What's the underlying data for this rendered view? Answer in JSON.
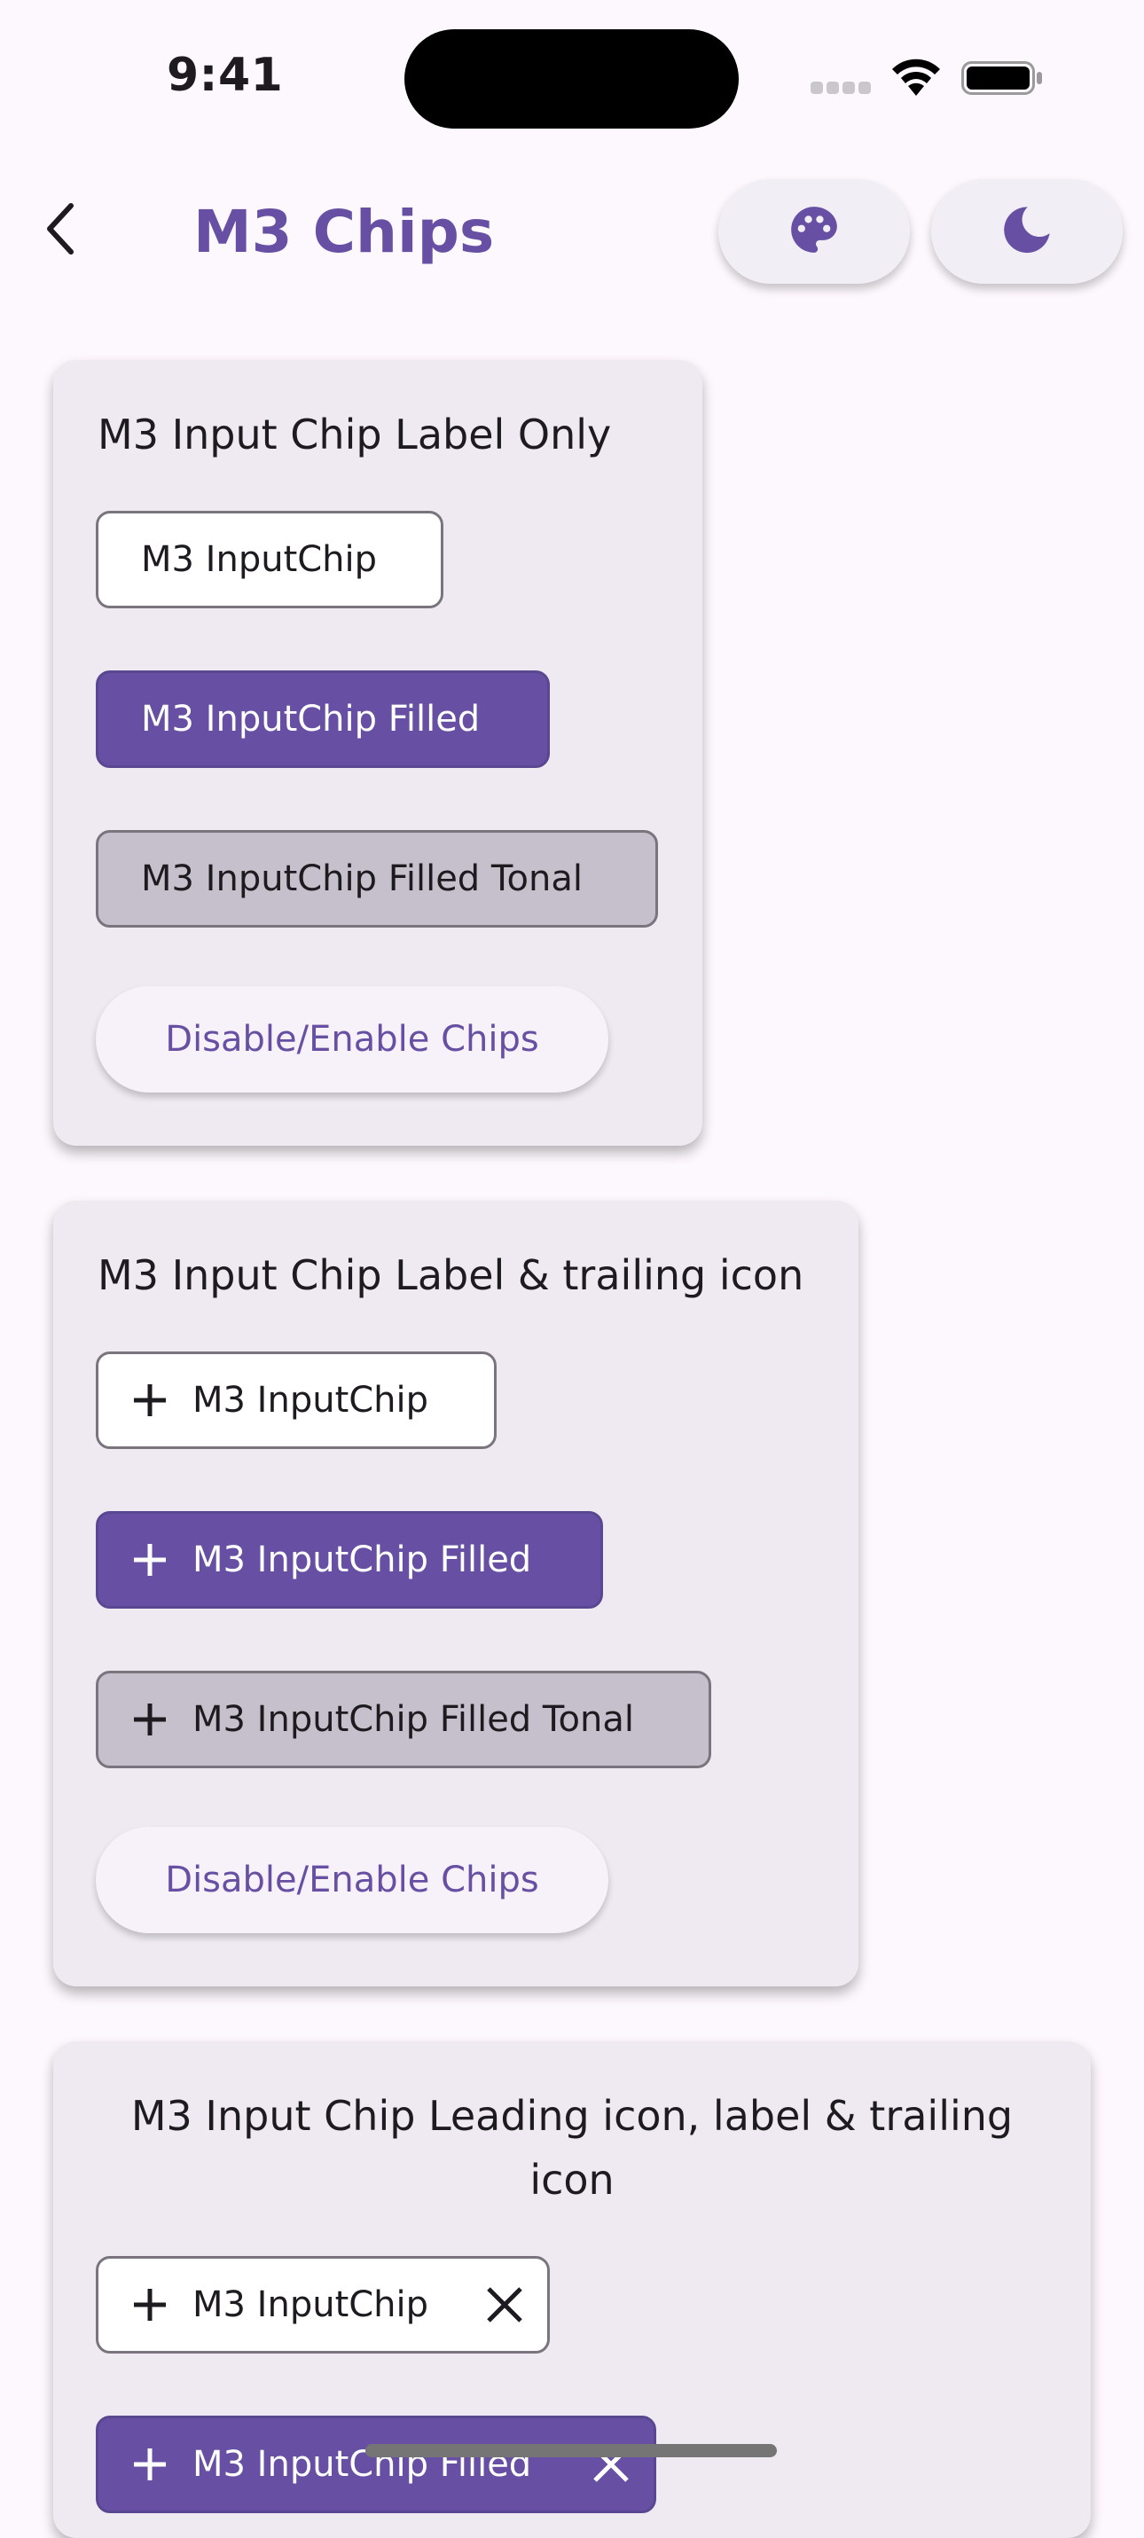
{
  "status_bar": {
    "time": "9:41"
  },
  "app_bar": {
    "title": "M3 Chips",
    "back_icon": "chevron-left-icon",
    "actions": [
      {
        "icon": "palette-icon"
      },
      {
        "icon": "moon-icon"
      }
    ]
  },
  "colors": {
    "primary": "#6750a4",
    "background": "#fdf8fd",
    "card": "#efeaf2",
    "tonal": "#c5c0cb"
  },
  "sections": [
    {
      "title": "M3 Input Chip Label Only",
      "chips": [
        {
          "label": "M3 InputChip",
          "style": "outlined"
        },
        {
          "label": "M3 InputChip Filled",
          "style": "filled"
        },
        {
          "label": "M3 InputChip Filled Tonal",
          "style": "tonal"
        }
      ],
      "toggle_button": "Disable/Enable Chips"
    },
    {
      "title": "M3 Input Chip Label & trailing icon",
      "chips": [
        {
          "label": "M3 InputChip",
          "style": "outlined",
          "icon": "plus-icon"
        },
        {
          "label": "M3 InputChip Filled",
          "style": "filled",
          "icon": "plus-icon"
        },
        {
          "label": "M3 InputChip Filled Tonal",
          "style": "tonal",
          "icon": "plus-icon"
        }
      ],
      "toggle_button": "Disable/Enable Chips"
    },
    {
      "title_line1": "M3 Input Chip Leading icon, label & trailing",
      "title_line2": "icon",
      "chips": [
        {
          "label": "M3 InputChip",
          "style": "outlined",
          "leading_icon": "plus-icon",
          "trailing_icon": "close-icon"
        },
        {
          "label": "M3 InputChip Filled",
          "style": "filled",
          "leading_icon": "plus-icon",
          "trailing_icon": "close-icon"
        }
      ]
    }
  ]
}
